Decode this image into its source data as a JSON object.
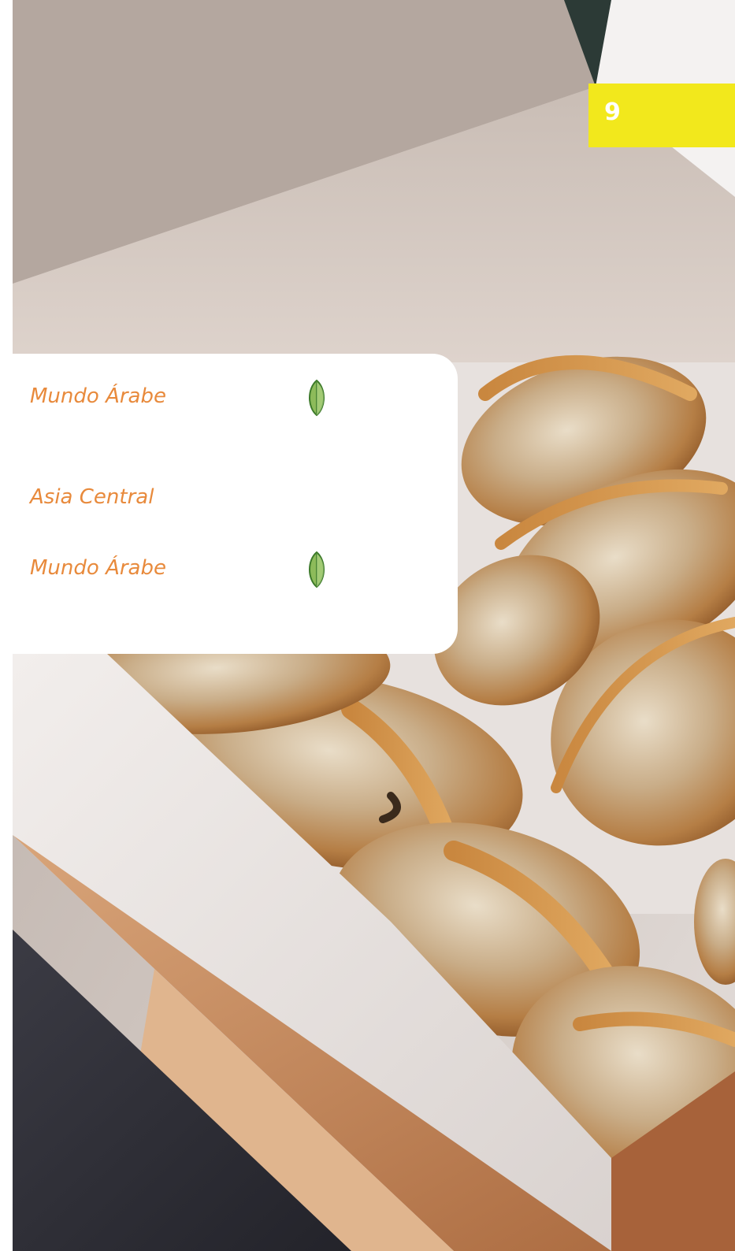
{
  "page": {
    "number": "9"
  },
  "menu": {
    "items": [
      {
        "label": "Mundo Árabe",
        "icon": "leaf-icon",
        "vegetarian": true
      },
      {
        "label": "Asia Central",
        "icon": null,
        "vegetarian": false
      },
      {
        "label": "Mundo Árabe",
        "icon": "leaf-icon",
        "vegetarian": true
      }
    ]
  },
  "colors": {
    "accent_yellow": "#f2e81c",
    "item_text": "#e88a3c",
    "leaf_fill": "#8dbb5a",
    "leaf_stroke": "#3d7a2a"
  },
  "image": {
    "subject": "fried dumplings in paper takeaway box"
  }
}
